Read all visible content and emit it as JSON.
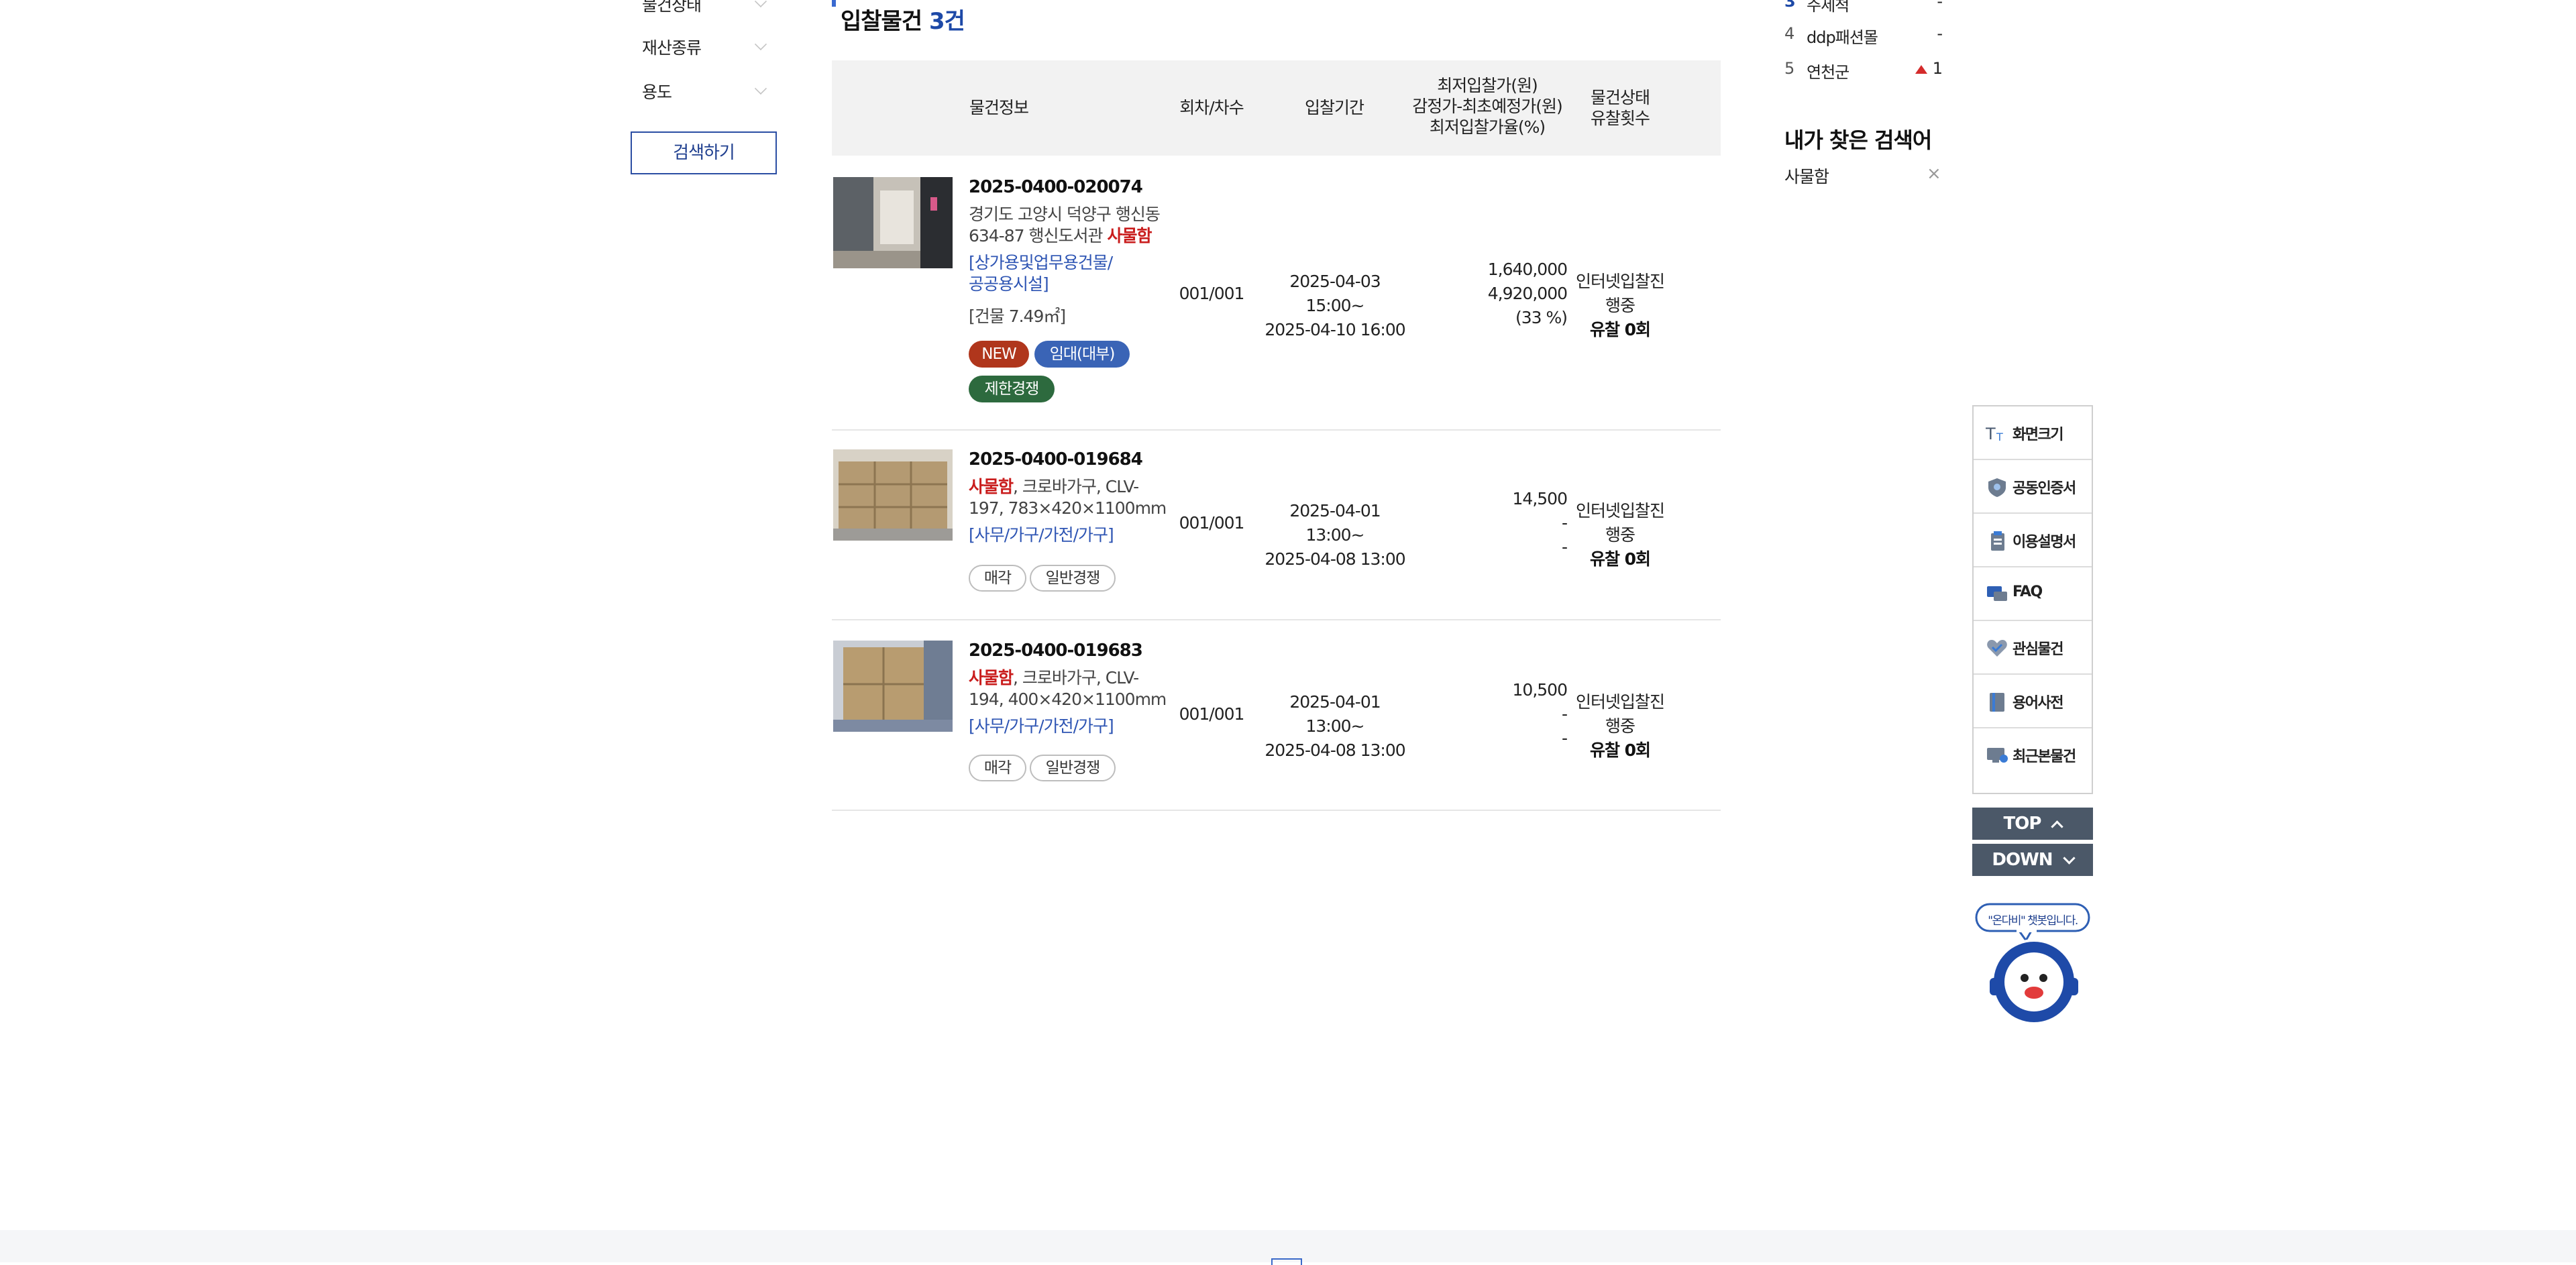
{
  "filters": {
    "items": [
      {
        "label": "물건상태"
      },
      {
        "label": "재산종류"
      },
      {
        "label": "용도"
      }
    ],
    "search_button": "검색하기"
  },
  "list": {
    "title": "입찰물건",
    "count": "3건",
    "headers": {
      "info": "물건정보",
      "round": "회차/차수",
      "period": "입찰기간",
      "price_line1": "최저입찰가(원)",
      "price_line2": "감정가-최초예정가(원)",
      "price_line3": "최저입찰가율(%)",
      "status_line1": "물건상태",
      "status_line2": "유찰횟수"
    },
    "rows": [
      {
        "case": "2025-0400-020074",
        "desc_line1": "경기도 고양시 덕양구 행신동",
        "desc_line2": "634-87 행신도서관 ",
        "desc_hl": "사물함",
        "usage_line1": "[상가용및업무용건물/",
        "usage_line2": "공공용시설]",
        "area": "[건물 7.49㎡]",
        "round": "001/001",
        "period_start": "2025-04-03 15:00~",
        "period_end": "2025-04-10 16:00",
        "price": "1,640,000",
        "appraisal": "4,920,000",
        "rate": "(33 %)",
        "status": "인터넷입찰진행중",
        "fail": "유찰 0회",
        "badges": [
          "NEW",
          "임대(대부)",
          "제한경쟁"
        ]
      },
      {
        "case": "2025-0400-019684",
        "desc_hl": "사물함",
        "desc_line1": ", 크로바가구, CLV-",
        "desc_line2": "197, 783×420×1100mm",
        "usage_line1": "[사무/가구/가전/가구]",
        "round": "001/001",
        "period_start": "2025-04-01 13:00~",
        "period_end": "2025-04-08 13:00",
        "price": "14,500",
        "appraisal": "-",
        "rate": "-",
        "status": "인터넷입찰진행중",
        "fail": "유찰 0회",
        "badges": [
          "매각",
          "일반경쟁"
        ]
      },
      {
        "case": "2025-0400-019683",
        "desc_hl": "사물함",
        "desc_line1": ", 크로바가구, CLV-",
        "desc_line2": "194, 400×420×1100mm",
        "usage_line1": "[사무/가구/가전/가구]",
        "round": "001/001",
        "period_start": "2025-04-01 13:00~",
        "period_end": "2025-04-08 13:00",
        "price": "10,500",
        "appraisal": "-",
        "rate": "-",
        "status": "인터넷입찰진행중",
        "fail": "유찰 0회",
        "badges": [
          "매각",
          "일반경쟁"
        ]
      }
    ]
  },
  "ranking": {
    "items": [
      {
        "num": "3",
        "name": "주세척",
        "change": "-"
      },
      {
        "num": "4",
        "name": "ddp패션몰",
        "change": "-"
      },
      {
        "num": "5",
        "name": "연천군",
        "change": "1"
      }
    ]
  },
  "my_search": {
    "title": "내가 찾은 검색어",
    "item": "사물함",
    "close": "×"
  },
  "quick_menu": {
    "items": [
      {
        "label": "화면크기",
        "icon": "text-size-icon"
      },
      {
        "label": "공동인증서",
        "icon": "certificate-icon"
      },
      {
        "label": "이용설명서",
        "icon": "manual-icon"
      },
      {
        "label": "FAQ",
        "icon": "faq-icon"
      },
      {
        "label": "관심물건",
        "icon": "heart-check-icon"
      },
      {
        "label": "용어사전",
        "icon": "dictionary-icon"
      },
      {
        "label": "최근본물건",
        "icon": "recent-view-icon"
      }
    ],
    "top": "TOP",
    "down": "DOWN",
    "chatbot_bubble": "\"온다비\" 챗봇입니다."
  },
  "colors": {
    "accent_blue": "#1d49a7",
    "highlight_red": "#c91d1d",
    "badge_new": "#b0361c",
    "badge_lease": "#3a64b6",
    "badge_limit": "#2d6a3e",
    "topdown_bg": "#4b5868"
  }
}
